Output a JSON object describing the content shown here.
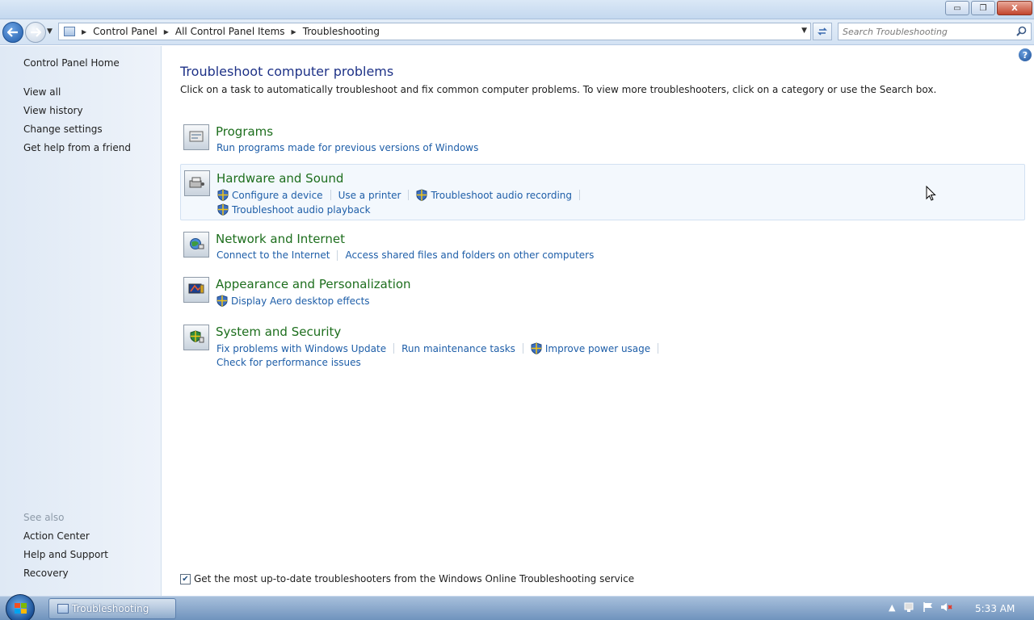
{
  "window": {
    "buttons": {
      "minimize": "▭",
      "maximize": "❐",
      "close": "X"
    }
  },
  "nav": {
    "breadcrumbs": [
      "Control Panel",
      "All Control Panel Items",
      "Troubleshooting"
    ],
    "search_placeholder": "Search Troubleshooting"
  },
  "sidebar": {
    "home": "Control Panel Home",
    "links": [
      "View all",
      "View history",
      "Change settings",
      "Get help from a friend"
    ],
    "see_also_label": "See also",
    "see_also": [
      "Action Center",
      "Help and Support",
      "Recovery"
    ]
  },
  "main": {
    "title": "Troubleshoot computer problems",
    "description": "Click on a task to automatically troubleshoot and fix common computer problems. To view more troubleshooters, click on a category or use the Search box.",
    "categories": [
      {
        "title": "Programs",
        "tasks": [
          "Run programs made for previous versions of Windows"
        ]
      },
      {
        "title": "Hardware and Sound",
        "tasks": [
          "Configure a device",
          "Use a printer",
          "Troubleshoot audio recording",
          "Troubleshoot audio playback"
        ]
      },
      {
        "title": "Network and Internet",
        "tasks": [
          "Connect to the Internet",
          "Access shared files and folders on other computers"
        ]
      },
      {
        "title": "Appearance and Personalization",
        "tasks": [
          "Display Aero desktop effects"
        ]
      },
      {
        "title": "System and Security",
        "tasks": [
          "Fix problems with Windows Update",
          "Run maintenance tasks",
          "Improve power usage",
          "Check for performance issues"
        ]
      }
    ],
    "online_option": {
      "label": "Get the most up-to-date troubleshooters from the Windows Online Troubleshooting service",
      "checked": true
    }
  },
  "taskbar": {
    "window_label": "Troubleshooting",
    "tray_chevron": "▲",
    "clock": "5:33 AM"
  },
  "colors": {
    "category_title": "#1d6e1d",
    "task_link": "#1e5ea8",
    "page_title": "#1e3287"
  }
}
